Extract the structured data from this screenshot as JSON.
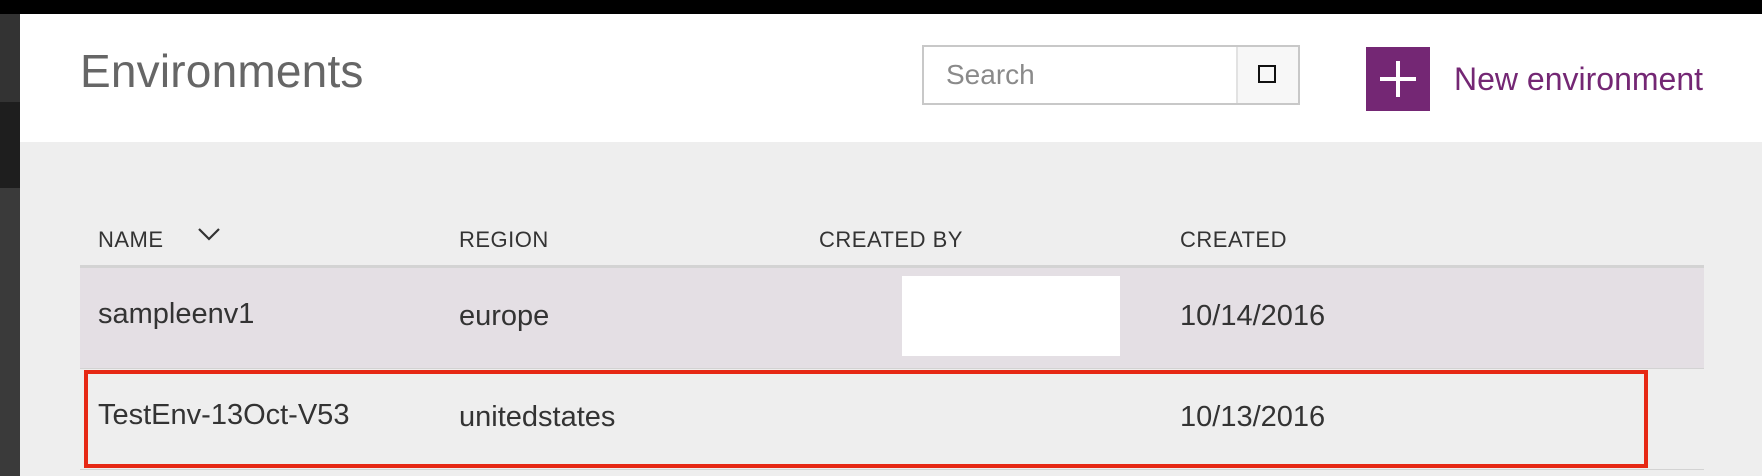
{
  "header": {
    "title": "Environments",
    "search": {
      "placeholder": "Search",
      "value": "",
      "button_icon": "search-toggle-square-icon"
    },
    "new_environment": {
      "icon": "plus-icon",
      "label": "New environment"
    }
  },
  "table": {
    "columns": [
      {
        "label": "NAME",
        "sorted": true,
        "sort_icon": "chevron-down-icon"
      },
      {
        "label": "REGION"
      },
      {
        "label": "CREATED BY"
      },
      {
        "label": "CREATED"
      }
    ],
    "rows": [
      {
        "name": "sampleenv1",
        "region": "europe",
        "created_by": "",
        "created": "10/14/2016",
        "hovered": true
      },
      {
        "name": "TestEnv-13Oct-V53",
        "region": "unitedstates",
        "created_by": "",
        "created": "10/13/2016",
        "highlighted": true
      }
    ]
  },
  "colors": {
    "accent": "#742774",
    "highlight_border": "#e62814",
    "row_hover": "#e4dfe4",
    "content_bg": "#eeeeee"
  }
}
